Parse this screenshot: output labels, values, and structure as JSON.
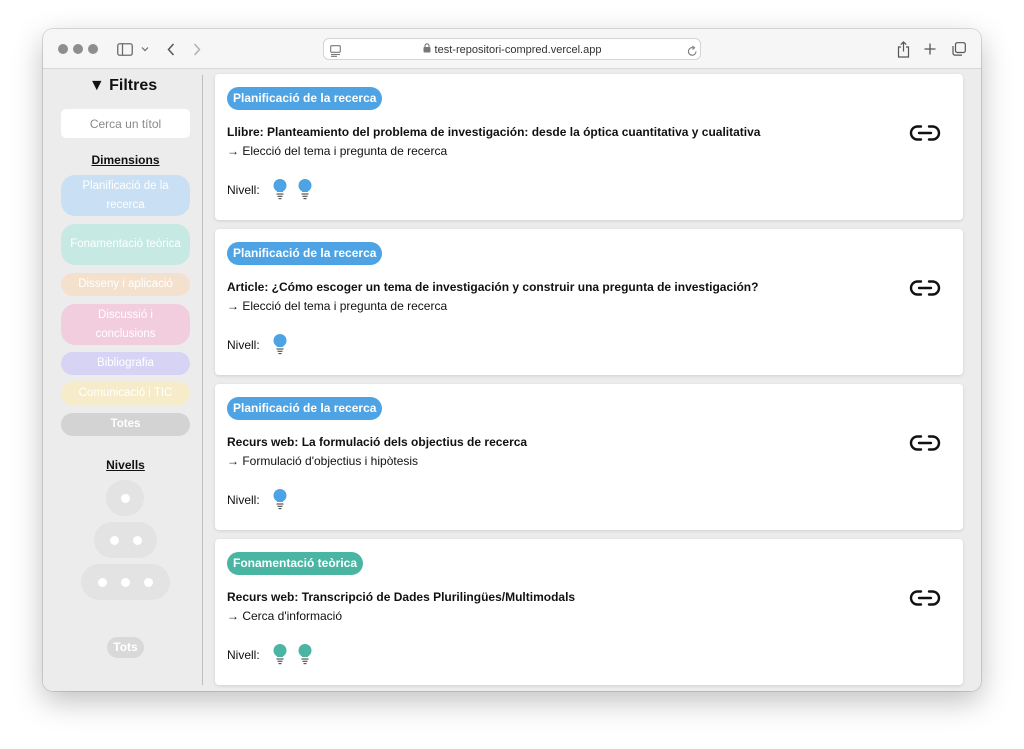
{
  "browser": {
    "url": "test-repositori-compred.vercel.app"
  },
  "sidebar": {
    "title": "▼ Filtres",
    "search_placeholder": "Cerca un títol",
    "dimensions_title": "Dimensions",
    "dimensions": [
      {
        "label": "Planificació de la recerca",
        "color": "#c9dff3"
      },
      {
        "label": "Fonamentació teòrica",
        "color": "#c6e9e3"
      },
      {
        "label": "Disseny i aplicació",
        "color": "#f4e1cd"
      },
      {
        "label": "Discussió i conclusions",
        "color": "#f2cdde"
      },
      {
        "label": "Bibliografia",
        "color": "#d6d3f4"
      },
      {
        "label": "Comunicació i TIC",
        "color": "#f6ecc9"
      },
      {
        "label": "Totes",
        "color": "#d3d3d3"
      }
    ],
    "levels_title": "Nivells",
    "levels_all": "Tots"
  },
  "resources": [
    {
      "category": "Planificació de la recerca",
      "color": "#4da3e3",
      "title": "Llibre: Planteamiento del problema de investigación: desde la óptica cuantitativa y cualitativa",
      "subtitle": "→ Elecció del tema i pregunta de recerca",
      "level_label": "Nivell:",
      "level": 2
    },
    {
      "category": "Planificació de la recerca",
      "color": "#4da3e3",
      "title": "Article: ¿Cómo escoger un tema de investigación y construir una pregunta de investigación?",
      "subtitle": "→ Elecció del tema i pregunta de recerca",
      "level_label": "Nivell:",
      "level": 1
    },
    {
      "category": "Planificació de la recerca",
      "color": "#4da3e3",
      "title": "Recurs web: La formulació dels objectius de recerca",
      "subtitle": "→ Formulació d'objectius i hipòtesis",
      "level_label": "Nivell:",
      "level": 1
    },
    {
      "category": "Fonamentació teòrica",
      "color": "#4ab5a2",
      "title": "Recurs web: Transcripció de Dades Plurilingües/Multimodals",
      "subtitle": "→ Cerca d'informació",
      "level_label": "Nivell:",
      "level": 2
    }
  ]
}
